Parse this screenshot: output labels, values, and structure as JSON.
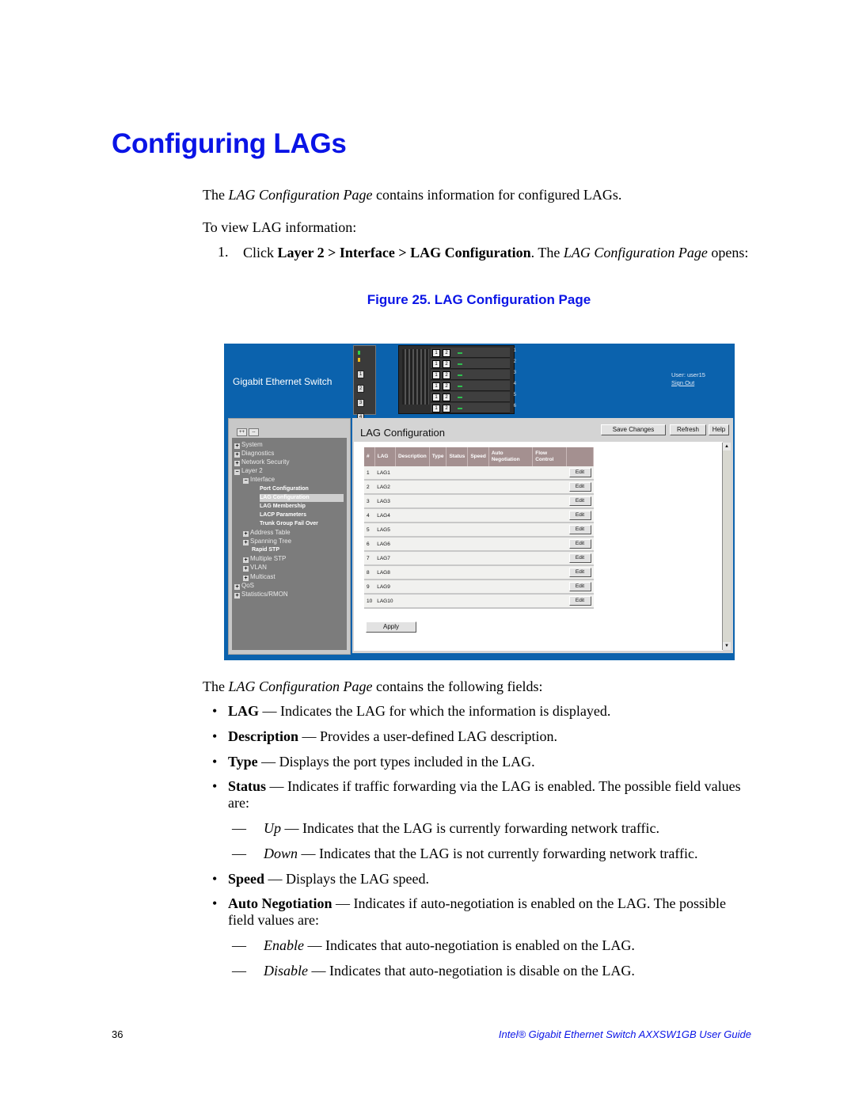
{
  "heading": "Configuring LAGs",
  "intro": {
    "pre": "The ",
    "italic": "LAG Configuration Page",
    "post": " contains information for configured LAGs."
  },
  "to_view": "To view LAG information:",
  "step1": {
    "num": "1.",
    "text_pre": "Click ",
    "bold": "Layer 2 > Interface > LAG Configuration",
    "mid": ". The ",
    "italic": "LAG Configuration Page",
    "post": " opens:"
  },
  "figure_caption": "Figure 25. LAG Configuration Page",
  "ui": {
    "brand": "Gigabit Ethernet Switch",
    "user_label": "User: user15",
    "sign_out": "Sign Out",
    "expand_all": "++",
    "collapse_all": "--",
    "page_title": "LAG Configuration",
    "buttons": {
      "save": "Save Changes",
      "refresh": "Refresh",
      "help": "Help",
      "apply": "Apply",
      "edit": "Edit"
    },
    "tree": [
      {
        "label": "System",
        "level": 0,
        "icon": "plus"
      },
      {
        "label": "Diagnostics",
        "level": 0,
        "icon": "plus"
      },
      {
        "label": "Network Security",
        "level": 0,
        "icon": "plus"
      },
      {
        "label": "Layer 2",
        "level": 0,
        "icon": "minus"
      },
      {
        "label": "Interface",
        "level": 1,
        "icon": "minus"
      },
      {
        "label": "Port Configuration",
        "level": 2,
        "icon": "none"
      },
      {
        "label": "LAG Configuration",
        "level": 2,
        "icon": "none",
        "selected": true
      },
      {
        "label": "LAG Membership",
        "level": 2,
        "icon": "none"
      },
      {
        "label": "LACP Parameters",
        "level": 2,
        "icon": "none"
      },
      {
        "label": "Trunk Group Fail Over",
        "level": 2,
        "icon": "none"
      },
      {
        "label": "Address Table",
        "level": 1,
        "icon": "plus"
      },
      {
        "label": "Spanning Tree",
        "level": 1,
        "icon": "plus"
      },
      {
        "label": "Rapid STP",
        "level": 1,
        "icon": "none",
        "bold": true
      },
      {
        "label": "Multiple STP",
        "level": 1,
        "icon": "plus"
      },
      {
        "label": "VLAN",
        "level": 1,
        "icon": "plus"
      },
      {
        "label": "Multicast",
        "level": 1,
        "icon": "plus"
      },
      {
        "label": "QoS",
        "level": 0,
        "icon": "plus"
      },
      {
        "label": "Statistics/RMON",
        "level": 0,
        "icon": "plus"
      }
    ],
    "columns": [
      "#",
      "LAG",
      "Description",
      "Type",
      "Status",
      "Speed",
      "Auto Negotiation",
      "Flow Control",
      ""
    ],
    "rows": [
      {
        "num": "1",
        "lag": "LAG1"
      },
      {
        "num": "2",
        "lag": "LAG2"
      },
      {
        "num": "3",
        "lag": "LAG3"
      },
      {
        "num": "4",
        "lag": "LAG4"
      },
      {
        "num": "5",
        "lag": "LAG5"
      },
      {
        "num": "6",
        "lag": "LAG6"
      },
      {
        "num": "7",
        "lag": "LAG7"
      },
      {
        "num": "8",
        "lag": "LAG8"
      },
      {
        "num": "9",
        "lag": "LAG9"
      },
      {
        "num": "10",
        "lag": "LAG10"
      }
    ]
  },
  "fields_intro": {
    "pre": "The ",
    "italic": "LAG Configuration Page",
    "post": " contains the following fields:"
  },
  "fields": [
    {
      "term": "LAG",
      "desc": " — Indicates the LAG for which the information is displayed."
    },
    {
      "term": "Description",
      "desc": " — Provides a user-defined LAG description."
    },
    {
      "term": "Type",
      "desc": " — Displays the port types included in the LAG."
    },
    {
      "term": "Status",
      "desc": " — Indicates if traffic forwarding via the LAG is enabled. The possible field values are:"
    },
    {
      "term": "Speed",
      "desc": " — Displays the LAG speed."
    },
    {
      "term": "Auto Negotiation",
      "desc": " — Indicates if auto-negotiation is enabled on the LAG. The possible field values are:"
    }
  ],
  "status_values": [
    {
      "term": "Up",
      "desc": " — Indicates that the LAG is currently forwarding network traffic."
    },
    {
      "term": "Down",
      "desc": " — Indicates that the LAG is not currently forwarding network traffic."
    }
  ],
  "autoneg_values": [
    {
      "term": "Enable",
      "desc": " — Indicates that auto-negotiation is enabled on the LAG."
    },
    {
      "term": "Disable",
      "desc": " — Indicates that auto-negotiation is disable on the LAG."
    }
  ],
  "footer": {
    "page_number": "36",
    "guide_title": "Intel® Gigabit Ethernet Switch AXXSW1GB User Guide"
  }
}
